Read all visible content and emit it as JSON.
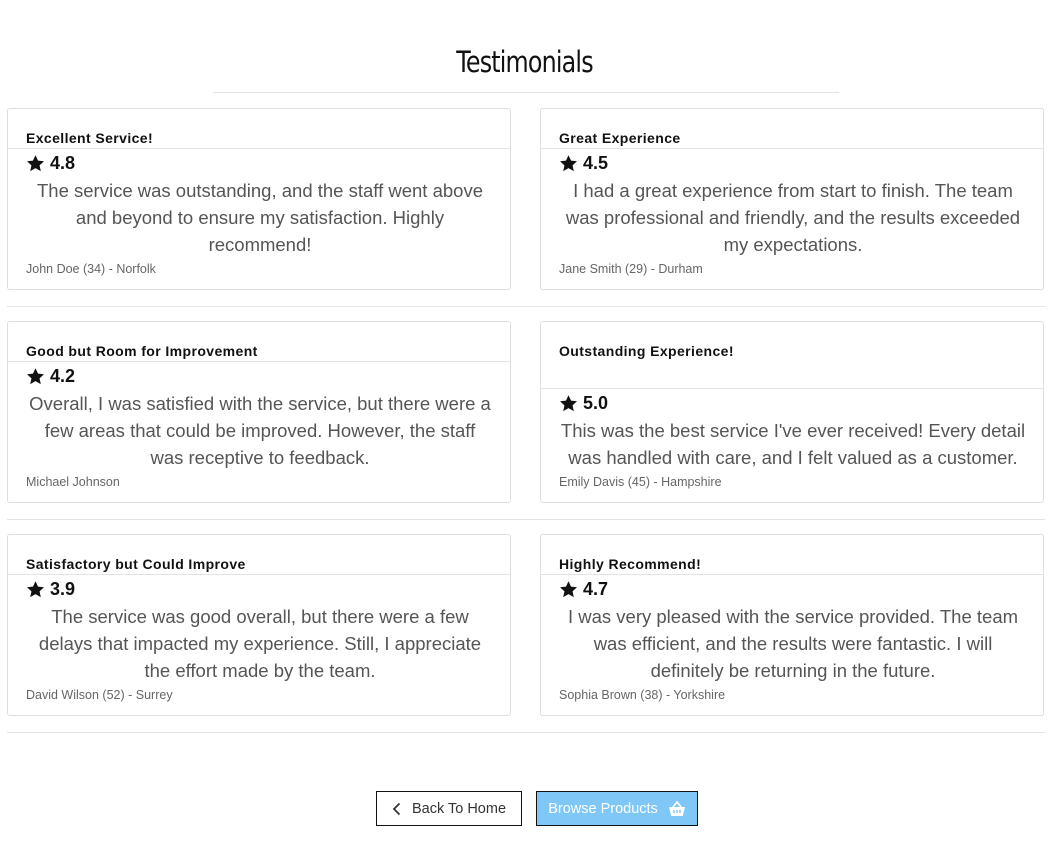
{
  "page": {
    "title": "Testimonials"
  },
  "testimonials": [
    {
      "title": "Excellent Service!",
      "rating": "4.8",
      "review": "The service was outstanding, and the staff went above and beyond to ensure my satisfaction. Highly recommend!",
      "author": "John Doe (34) - Norfolk"
    },
    {
      "title": "Great Experience",
      "rating": "4.5",
      "review": "I had a great experience from start to finish. The team was professional and friendly, and the results exceeded my expectations.",
      "author": "Jane Smith (29) - Durham"
    },
    {
      "title": "Good but Room for Improvement",
      "rating": "4.2",
      "review": "Overall, I was satisfied with the service, but there were a few areas that could be improved. However, the staff was receptive to feedback.",
      "author": "Michael Johnson"
    },
    {
      "title": "Outstanding Experience!",
      "rating": "5.0",
      "review": "This was the best service I've ever received! Every detail was handled with care, and I felt valued as a customer.",
      "author": "Emily Davis (45) - Hampshire"
    },
    {
      "title": "Satisfactory but Could Improve",
      "rating": "3.9",
      "review": "The service was good overall, but there were a few delays that impacted my experience. Still, I appreciate the effort made by the team.",
      "author": "David Wilson (52) - Surrey"
    },
    {
      "title": "Highly Recommend!",
      "rating": "4.7",
      "review": "I was very pleased with the service provided. The team was efficient, and the results were fantastic. I will definitely be returning in the future.",
      "author": "Sophia Brown (38) - Yorkshire"
    }
  ],
  "buttons": {
    "back_label": "Back To Home",
    "back_icon": "chevron-left-icon",
    "browse_label": "Browse Products",
    "browse_icon": "basket-icon",
    "browse_color": "#7fc7f6"
  },
  "icons": {
    "rating": "star-icon"
  }
}
